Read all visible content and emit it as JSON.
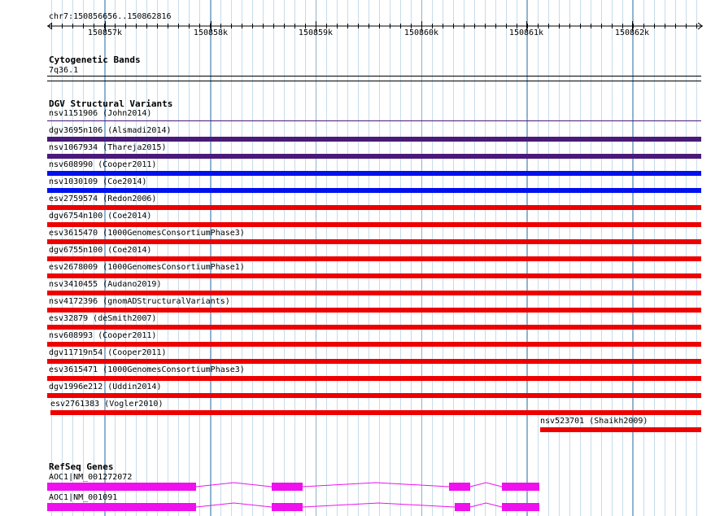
{
  "ruler": {
    "region": "chr7:150856656..150862816",
    "ticks": [
      "150857k",
      "150858k",
      "150859k",
      "150860k",
      "150861k",
      "150862k"
    ]
  },
  "cyto": {
    "title": "Cytogenetic Bands",
    "band": "7q36.1"
  },
  "dgv": {
    "title": "DGV Structural Variants",
    "variants": [
      {
        "label": "nsv1151906 (John2014)",
        "color": "#4a1a7a"
      },
      {
        "label": "dgv3695n106 (Alsmadi2014)",
        "color": "#4a1a7a"
      },
      {
        "label": "nsv1067934 (Thareja2015)",
        "color": "#4a1a7a"
      },
      {
        "label": "nsv608990 (Cooper2011)",
        "color": "#0010ee"
      },
      {
        "label": "nsv1030109 (Coe2014)",
        "color": "#0010ee"
      },
      {
        "label": "esv2759574 (Redon2006)",
        "color": "#ee0000"
      },
      {
        "label": "dgv6754n100 (Coe2014)",
        "color": "#ee0000"
      },
      {
        "label": "esv3615470 (1000GenomesConsortiumPhase3)",
        "color": "#ee0000"
      },
      {
        "label": "dgv6755n100 (Coe2014)",
        "color": "#ee0000"
      },
      {
        "label": "esv2678009 (1000GenomesConsortiumPhase1)",
        "color": "#ee0000"
      },
      {
        "label": "nsv3410455 (Audano2019)",
        "color": "#ee0000"
      },
      {
        "label": "nsv4172396 (gnomADStructuralVariants)",
        "color": "#ee0000"
      },
      {
        "label": "esv32879 (deSmith2007)",
        "color": "#ee0000"
      },
      {
        "label": "nsv608993 (Cooper2011)",
        "color": "#ee0000"
      },
      {
        "label": "dgv11719n54 (Cooper2011)",
        "color": "#ee0000"
      },
      {
        "label": "esv3615471 (1000GenomesConsortiumPhase3)",
        "color": "#ee0000"
      },
      {
        "label": "dgv1996e212 (Uddin2014)",
        "color": "#ee0000"
      },
      {
        "label": "esv2761383 (Vogler2010)",
        "color": "#ee0000"
      },
      {
        "label": "nsv523701 (Shaikh2009)",
        "color": "#ee0000"
      }
    ]
  },
  "refseq": {
    "title": "RefSeq Genes",
    "genes": [
      {
        "label": "AOC1|NM_001272072",
        "color": "#ee11ee"
      },
      {
        "label": "AOC1|NM_001091",
        "color": "#ee11ee"
      }
    ]
  }
}
